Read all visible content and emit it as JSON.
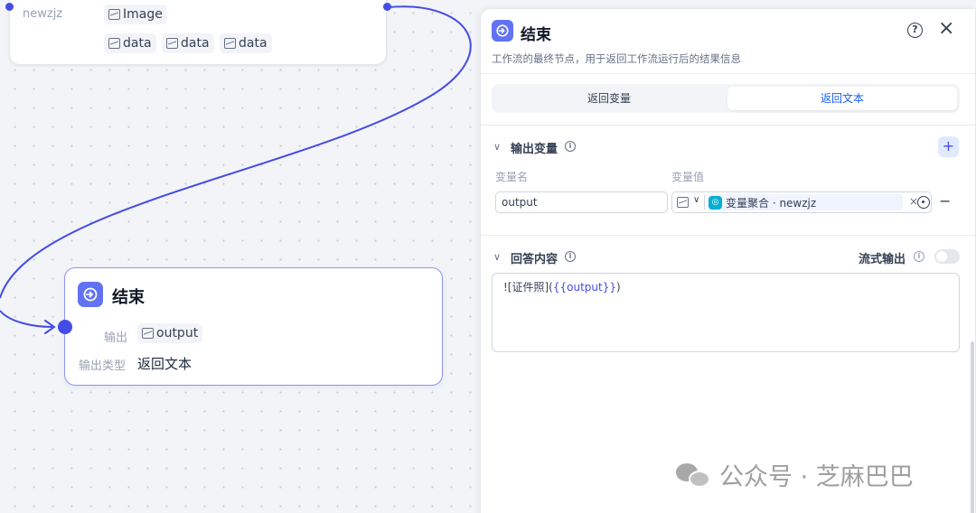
{
  "canvas": {
    "upper_node": {
      "row_label": "newzjz",
      "image_chip": "Image",
      "data_chips": [
        "data",
        "data",
        "data"
      ]
    },
    "end_node": {
      "title": "结束",
      "output_label": "输出",
      "output_value": "output",
      "output_type_label": "输出类型",
      "output_type_value": "返回文本"
    }
  },
  "panel": {
    "title": "结束",
    "description": "工作流的最终节点，用于返回工作流运行后的结果信息",
    "help_icon": "?",
    "close_icon": "×",
    "tabs": [
      {
        "label": "返回变量",
        "active": false
      },
      {
        "label": "返回文本",
        "active": true
      }
    ],
    "output_section": {
      "title": "输出变量",
      "col_name": "变量名",
      "col_value": "变量值",
      "name_value": "output",
      "var_ref": "变量聚合 · newzjz",
      "add_icon": "+",
      "remove_icon": "−"
    },
    "answer_section": {
      "title": "回答内容",
      "stream_label": "流式输出",
      "stream_enabled": false,
      "content_prefix": "![证件照](",
      "content_var": "{{output}}",
      "content_suffix": ")"
    }
  },
  "watermark": {
    "text": "公众号 · 芝麻巴巴"
  },
  "colors": {
    "accent": "#444ce7",
    "node_icon": "#6172f3",
    "active_tab_text": "#155eef",
    "aggregator_icon": "#06aed4"
  }
}
